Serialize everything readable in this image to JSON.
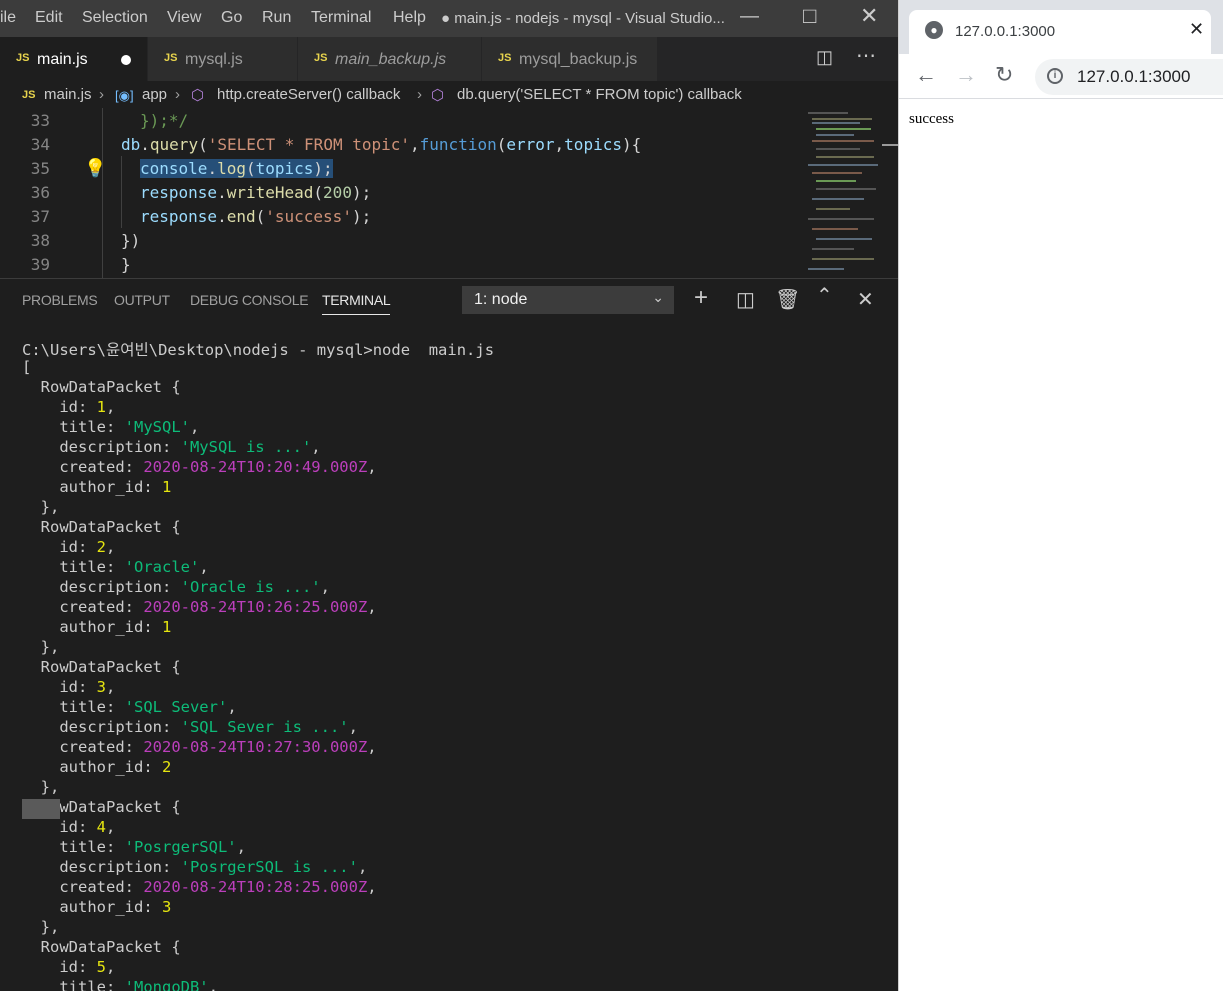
{
  "window": {
    "title": "● main.js - nodejs - mysql - Visual Studio...",
    "menu": [
      "ile",
      "Edit",
      "Selection",
      "View",
      "Go",
      "Run",
      "Terminal",
      "Help"
    ]
  },
  "tabs": [
    {
      "label": "main.js",
      "modified": true
    },
    {
      "label": "mysql.js"
    },
    {
      "label": "main_backup.js"
    },
    {
      "label": "mysql_backup.js"
    }
  ],
  "breadcrumb": [
    "main.js",
    "app",
    "http.createServer() callback",
    "db.query('SELECT * FROM topic') callback"
  ],
  "editor": {
    "line_numbers": [
      "33",
      "34",
      "35",
      "36",
      "37",
      "38",
      "39"
    ]
  },
  "panel": {
    "tabs": [
      "PROBLEMS",
      "OUTPUT",
      "DEBUG CONSOLE",
      "TERMINAL"
    ],
    "terminal_select": "1: node"
  },
  "terminal": {
    "prompt": "C:\\Users\\윤여빈\\Desktop\\nodejs - mysql>node  main.js",
    "open_bracket": "[",
    "records": [
      {
        "id": "1",
        "title": "'MySQL'",
        "description": "'MySQL is ...'",
        "created": "2020-08-24T10:20:49.000Z",
        "author_id": "1"
      },
      {
        "id": "2",
        "title": "'Oracle'",
        "description": "'Oracle is ...'",
        "created": "2020-08-24T10:26:25.000Z",
        "author_id": "1"
      },
      {
        "id": "3",
        "title": "'SQL Sever'",
        "description": "'SQL Sever is ...'",
        "created": "2020-08-24T10:27:30.000Z",
        "author_id": "2"
      },
      {
        "id": "4",
        "title": "'PosrgerSQL'",
        "description": "'PosrgerSQL is ...'",
        "created": "2020-08-24T10:28:25.000Z",
        "author_id": "3"
      }
    ],
    "partial": {
      "id": "5",
      "title": "'MongoDB'"
    },
    "packet_label": "RowDataPacket {"
  },
  "browser": {
    "tab_title": "127.0.0.1:3000",
    "url": "127.0.0.1:3000",
    "body_text": "success"
  },
  "colors": {
    "editor_bg": "#1e1e1e",
    "titlebar_bg": "#3c3c3c",
    "string_green": "#0dbc79",
    "number_yellow": "#e5e510",
    "date_magenta": "#bc3fbc"
  }
}
